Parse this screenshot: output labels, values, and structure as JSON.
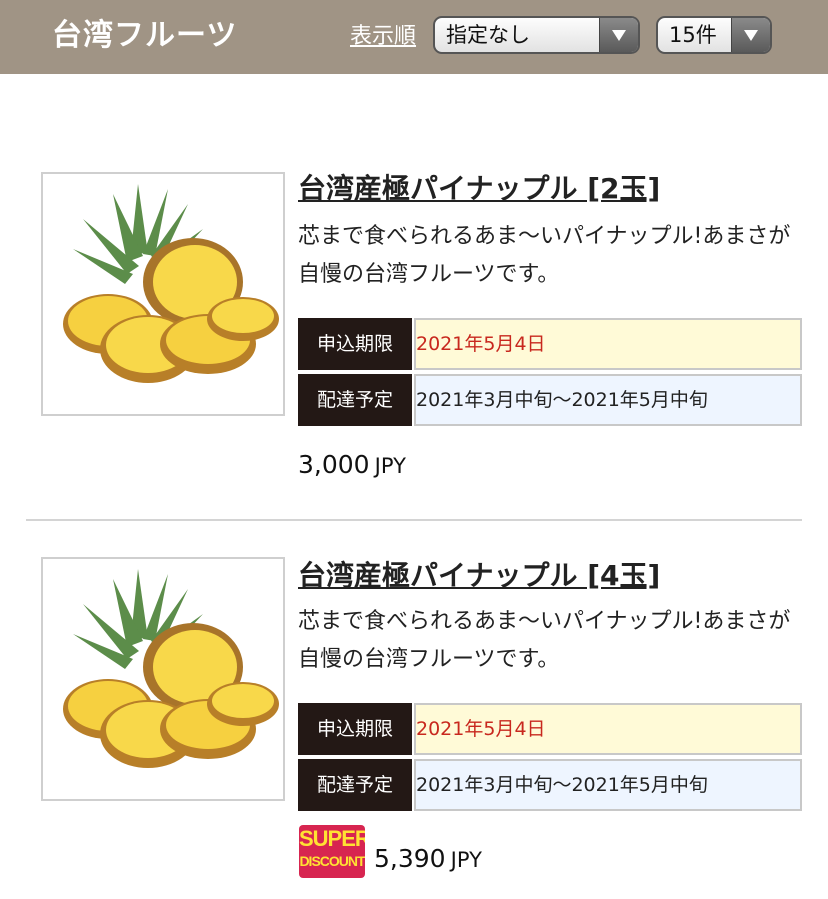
{
  "header": {
    "title": "台湾フルーツ",
    "sort_label": "表示順",
    "order_select": {
      "value": "指定なし"
    },
    "count_select": {
      "value": "15件"
    }
  },
  "items": [
    {
      "title": "台湾産極パイナップル [2玉]",
      "description": "芯まで食べられるあま〜いパイナップル!あまさが自慢の台湾フルーツです。",
      "deadline_label": "申込期限",
      "deadline_value": "2021年5月4日",
      "delivery_label": "配達予定",
      "delivery_value": "2021年3月中旬〜2021年5月中旬",
      "price": "3,000",
      "currency": "JPY"
    },
    {
      "title": "台湾産極パイナップル [4玉]",
      "description": "芯まで食べられるあま〜いパイナップル!あまさが自慢の台湾フルーツです。",
      "deadline_label": "申込期限",
      "deadline_value": "2021年5月4日",
      "delivery_label": "配達予定",
      "delivery_value": "2021年3月中旬〜2021年5月中旬",
      "price": "5,390",
      "currency": "JPY",
      "badge_line1": "SUPER",
      "badge_line2": "DISCOUNT"
    }
  ]
}
